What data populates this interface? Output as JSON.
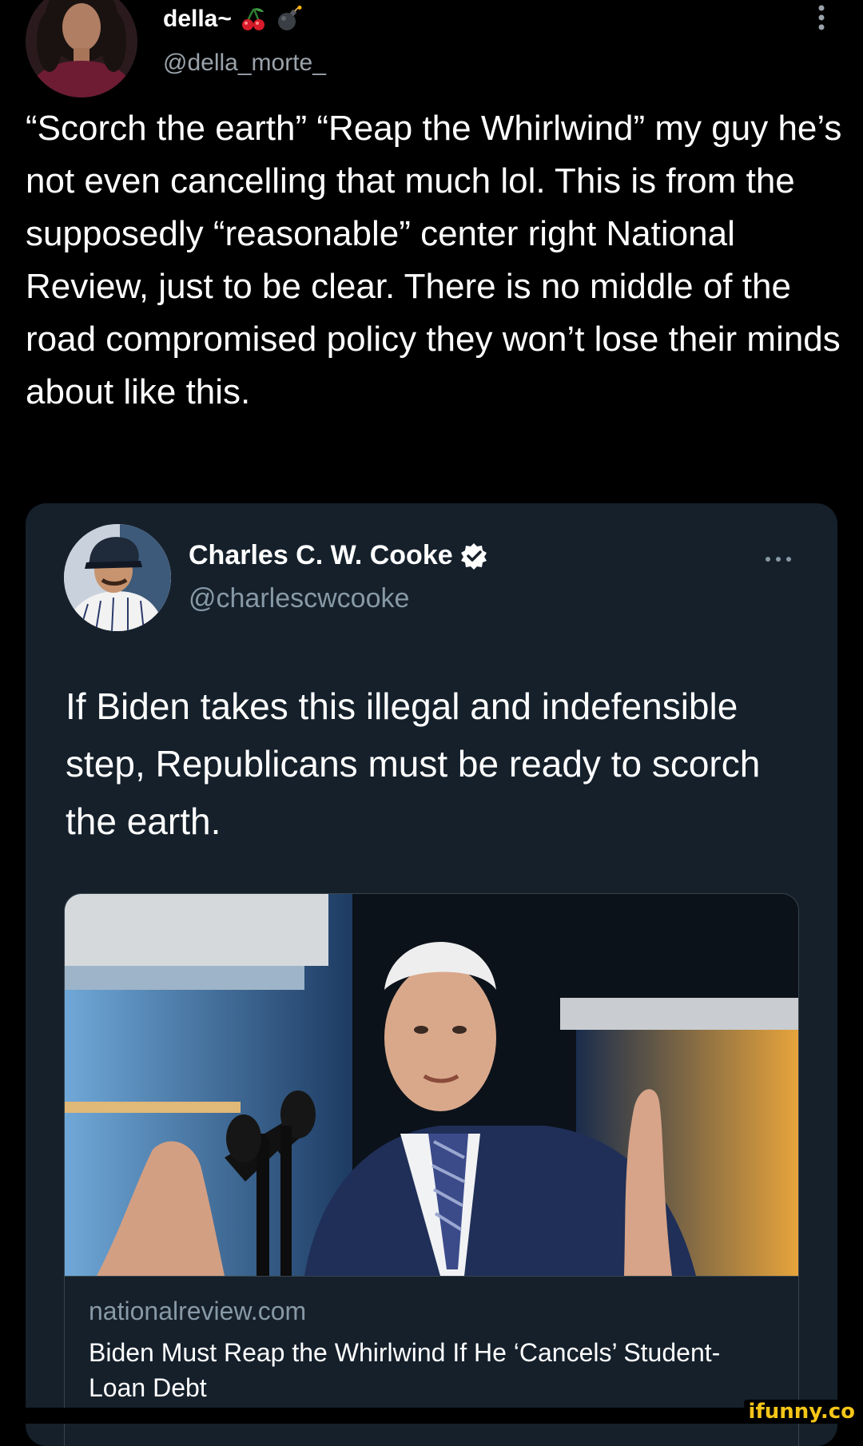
{
  "tweet": {
    "display_name": "della~",
    "display_name_emojis": [
      "cherries-emoji",
      "bomb-emoji"
    ],
    "handle": "@della_morte_",
    "text": "“Scorch the earth” “Reap the Whirlwind” my guy he’s not even cancelling that much lol. This is from the supposedly “reasonable” center right National Review, just to be clear. There is no middle of the road compromised policy they won’t lose their minds about like this."
  },
  "quoted_tweet": {
    "display_name": "Charles C. W. Cooke",
    "verified": true,
    "handle": "@charlescwcooke",
    "text": "If Biden takes this illegal and indefensible step, Republicans must be ready to scorch the earth.",
    "link_card": {
      "domain": "nationalreview.com",
      "title": "Biden Must Reap the Whirlwind If He ‘Cancels’ Student-Loan Debt"
    }
  },
  "watermark": "ifunny.co",
  "colors": {
    "background": "#000000",
    "card_background": "#15202b",
    "card_border": "#38444d",
    "secondary_text": "#8899a6",
    "verified_blue": "#1d9bf0",
    "watermark_yellow": "#f5c518"
  }
}
